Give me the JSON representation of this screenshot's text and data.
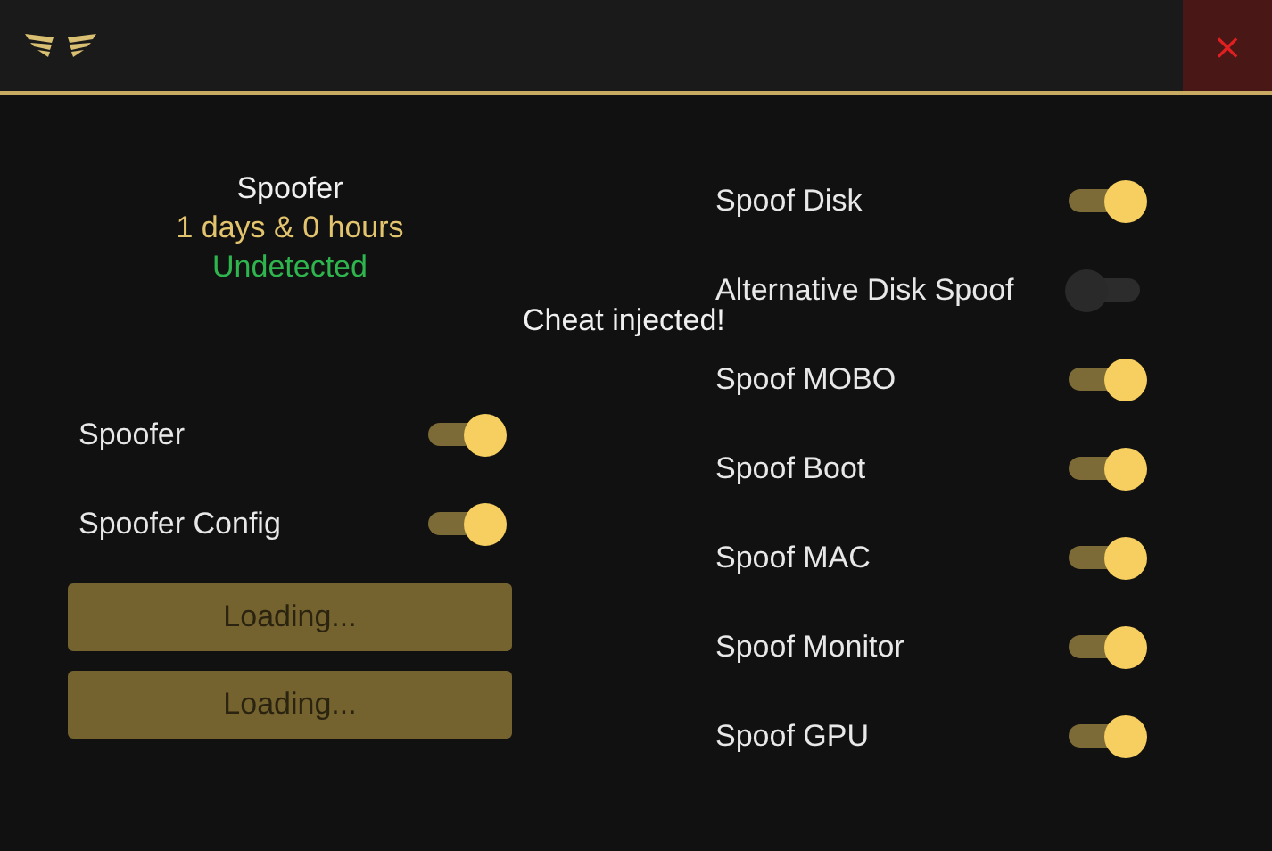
{
  "window": {
    "close": "×"
  },
  "status": {
    "product": "Spoofer",
    "time_left": "1 days & 0 hours",
    "state": "Undetected"
  },
  "left_toggles": [
    {
      "label": "Spoofer",
      "on": true
    },
    {
      "label": "Spoofer Config",
      "on": true
    }
  ],
  "buttons": [
    {
      "label": "Loading...",
      "disabled": true
    },
    {
      "label": "Loading...",
      "disabled": true
    }
  ],
  "right_toggles": [
    {
      "label": "Spoof Disk",
      "on": true
    },
    {
      "label": "Alternative Disk Spoof",
      "on": false
    },
    {
      "label": "Spoof MOBO",
      "on": true
    },
    {
      "label": "Spoof Boot",
      "on": true
    },
    {
      "label": "Spoof MAC",
      "on": true
    },
    {
      "label": "Spoof Monitor",
      "on": true
    },
    {
      "label": "Spoof GPU",
      "on": true
    }
  ],
  "toast": "Cheat injected!"
}
